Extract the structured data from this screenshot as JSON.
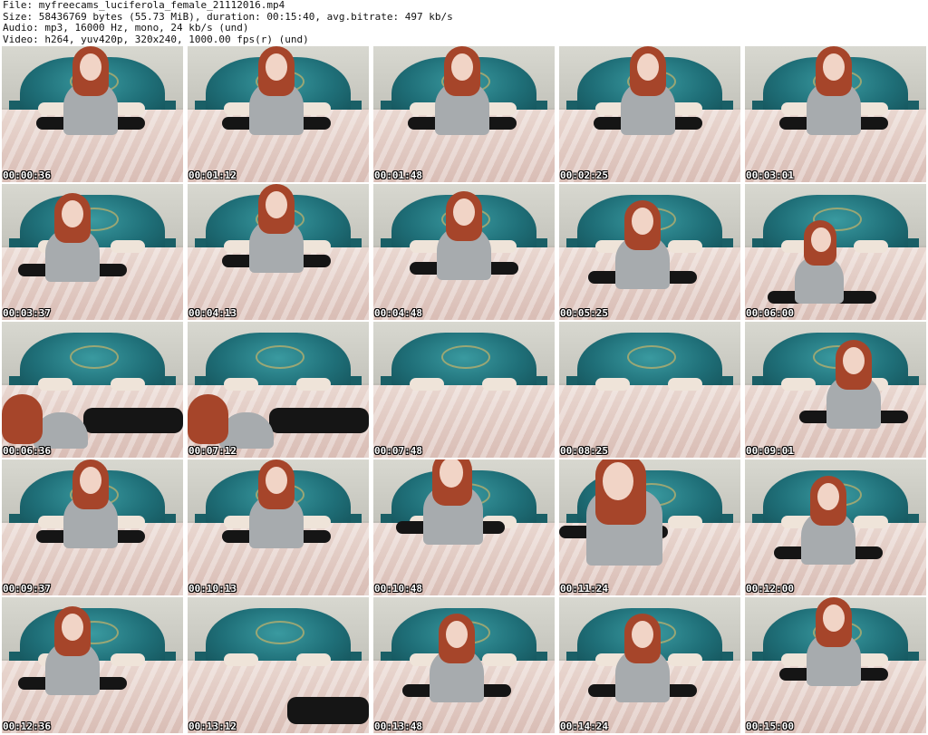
{
  "header": {
    "file": "File: myfreecams_luciferola_female_21112016.mp4",
    "size": "Size: 58436769 bytes (55.73 MiB), duration: 00:15:40, avg.bitrate: 497 kb/s",
    "audio": "Audio: mp3, 16000 Hz, mono, 24 kb/s (und)",
    "video": "Video: h264, yuv420p, 320x240, 1000.00 fps(r) (und)"
  },
  "thumbnails": [
    {
      "time": "00:00:36",
      "scene": "sitting-center"
    },
    {
      "time": "00:01:12",
      "scene": "sitting-center"
    },
    {
      "time": "00:01:48",
      "scene": "sitting-center"
    },
    {
      "time": "00:02:25",
      "scene": "sitting-center"
    },
    {
      "time": "00:03:01",
      "scene": "sitting-center"
    },
    {
      "time": "00:03:37",
      "scene": "sitting-left"
    },
    {
      "time": "00:04:13",
      "scene": "sitting-center"
    },
    {
      "time": "00:04:48",
      "scene": "hand-in-hair"
    },
    {
      "time": "00:05:25",
      "scene": "looking-down"
    },
    {
      "time": "00:06:00",
      "scene": "lying"
    },
    {
      "time": "00:06:36",
      "scene": "lying-left"
    },
    {
      "time": "00:07:12",
      "scene": "lying-left"
    },
    {
      "time": "00:07:48",
      "scene": "empty"
    },
    {
      "time": "00:08:25",
      "scene": "empty"
    },
    {
      "time": "00:09:01",
      "scene": "sitting-right"
    },
    {
      "time": "00:09:37",
      "scene": "sitting-center"
    },
    {
      "time": "00:10:13",
      "scene": "sitting-center"
    },
    {
      "time": "00:10:48",
      "scene": "leaning"
    },
    {
      "time": "00:11:24",
      "scene": "close-up"
    },
    {
      "time": "00:12:00",
      "scene": "looking-down"
    },
    {
      "time": "00:12:36",
      "scene": "sitting-left"
    },
    {
      "time": "00:13:12",
      "scene": "legs-only"
    },
    {
      "time": "00:13:48",
      "scene": "looking-down"
    },
    {
      "time": "00:14:24",
      "scene": "looking-down"
    },
    {
      "time": "00:15:00",
      "scene": "sitting-center"
    }
  ]
}
